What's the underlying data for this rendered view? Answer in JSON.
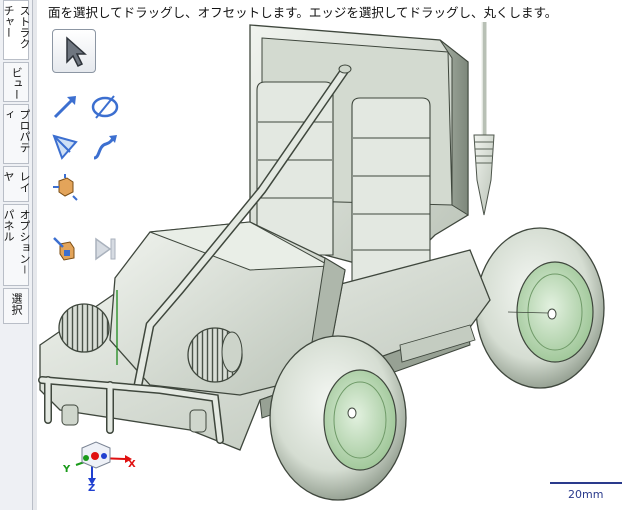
{
  "hint_text": "面を選択してドラッグし、オフセットします。エッジを選択してドラッグし、丸くします。",
  "side_tabs": [
    {
      "label": "ストラクチャー"
    },
    {
      "label": "ビュー"
    },
    {
      "label": "プロパティ"
    },
    {
      "label": "レイヤ"
    },
    {
      "label": "オプション－パネル"
    },
    {
      "label": "選択"
    }
  ],
  "tools": [
    {
      "icon": "select-arrow-icon"
    },
    {
      "icon": "pull-arrow-icon"
    },
    {
      "icon": "revolve-icon"
    },
    {
      "icon": "sweep-icon"
    },
    {
      "icon": "blend-icon"
    },
    {
      "icon": "up-to-icon"
    },
    {
      "icon": "fit-to-icon"
    },
    {
      "icon": "play-complete-icon"
    }
  ],
  "axis": {
    "x": "X",
    "y": "Y",
    "z": "Z"
  },
  "scale_bar": {
    "label": "20mm"
  },
  "colors": {
    "body": "#d9e0d6",
    "wheel_rim": "#bcd8b6",
    "axis_x": "#e01010",
    "axis_y": "#1a9a1a",
    "axis_z": "#2040d0"
  }
}
